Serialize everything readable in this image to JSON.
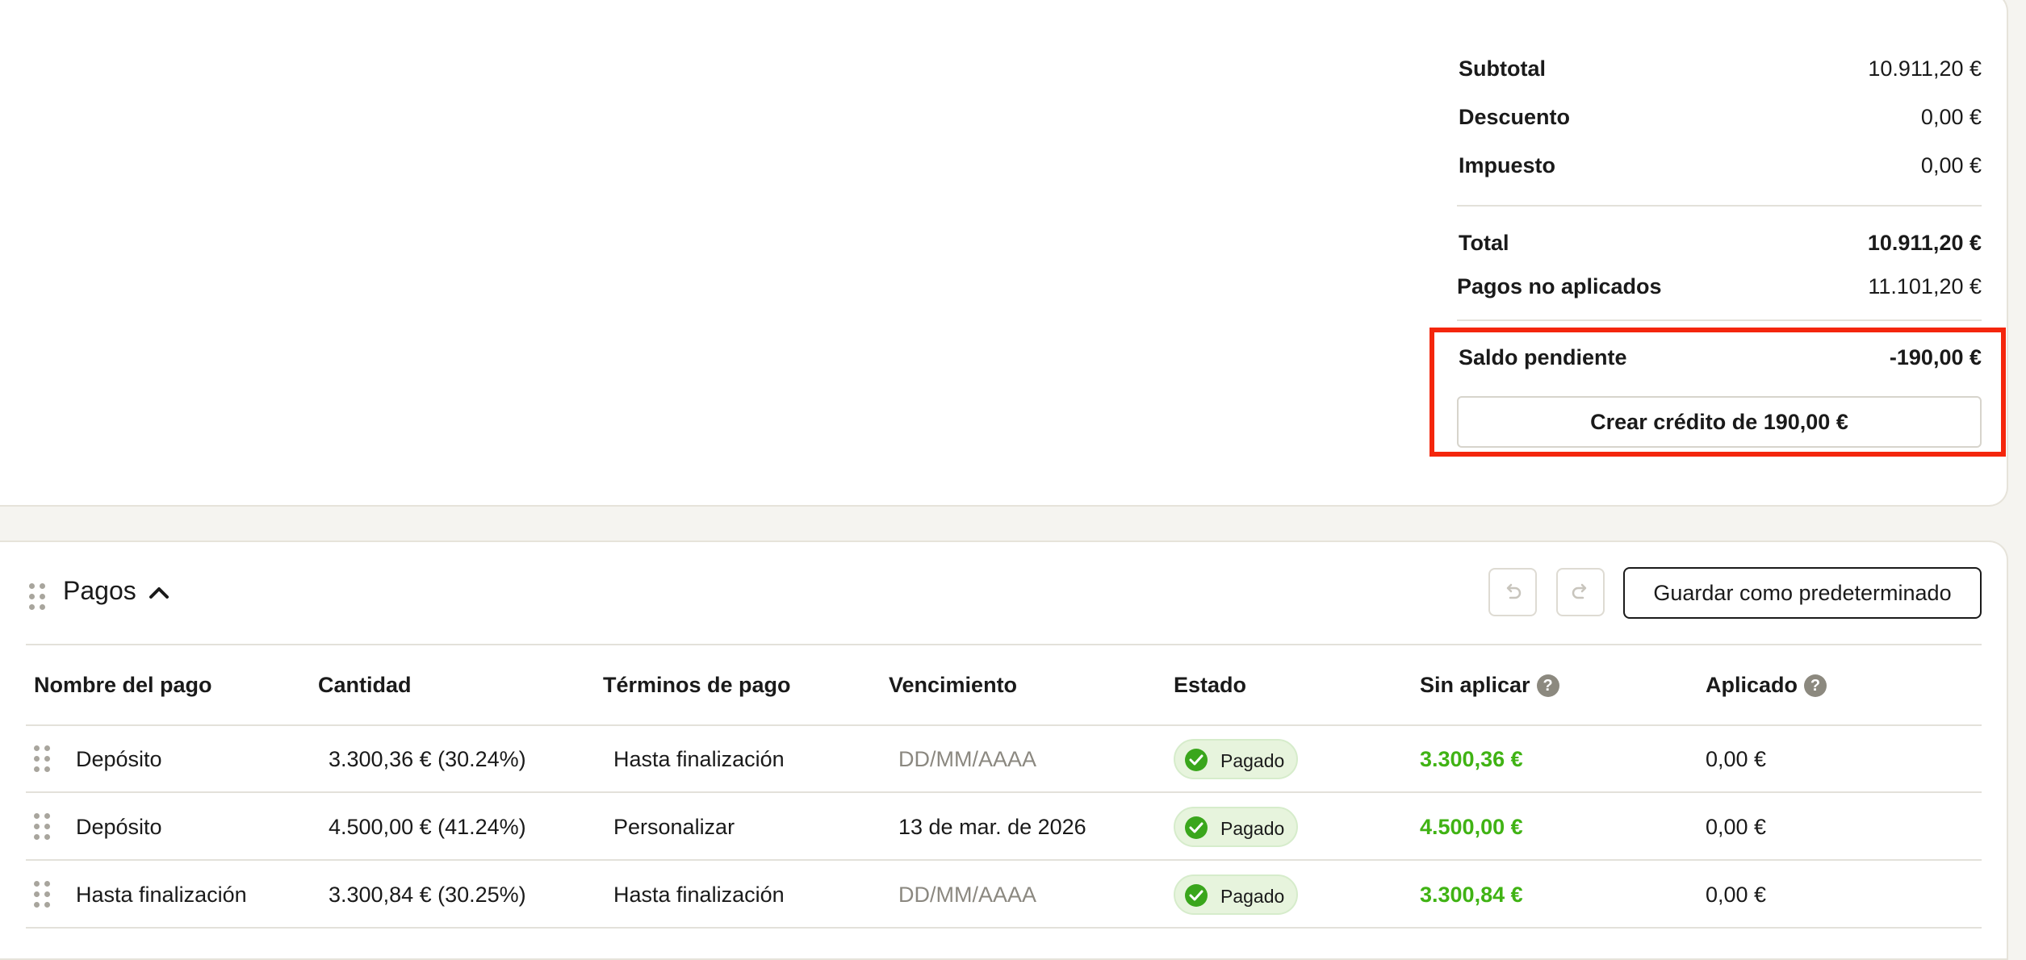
{
  "summary": {
    "subtotal_label": "Subtotal",
    "subtotal_value": "10.911,20 €",
    "discount_label": "Descuento",
    "discount_value": "0,00 €",
    "tax_label": "Impuesto",
    "tax_value": "0,00 €",
    "total_label": "Total",
    "total_value": "10.911,20 €",
    "unapplied_label": "Pagos no aplicados",
    "unapplied_value": "11.101,20 €",
    "balance_label": "Saldo pendiente",
    "balance_value": "-190,00 €",
    "credit_button": "Crear crédito de 190,00 €"
  },
  "payments": {
    "title": "Pagos",
    "save_default_button": "Guardar como predeterminado",
    "columns": {
      "name": "Nombre del pago",
      "amount": "Cantidad",
      "terms": "Términos de pago",
      "due": "Vencimiento",
      "status": "Estado",
      "unapplied": "Sin aplicar",
      "applied": "Aplicado"
    },
    "rows": [
      {
        "name": "Depósito",
        "amount": "3.300,36 € (30.24%)",
        "terms": "Hasta finalización",
        "due": "DD/MM/AAAA",
        "status": "Pagado",
        "unapplied": "3.300,36 €",
        "applied": "0,00 €"
      },
      {
        "name": "Depósito",
        "amount": "4.500,00 € (41.24%)",
        "terms": "Personalizar",
        "due": "13 de mar. de 2026",
        "status": "Pagado",
        "unapplied": "4.500,00 €",
        "applied": "0,00 €"
      },
      {
        "name": "Hasta finalización",
        "amount": "3.300,84 € (30.25%)",
        "terms": "Hasta finalización",
        "due": "DD/MM/AAAA",
        "status": "Pagado",
        "unapplied": "3.300,84 €",
        "applied": "0,00 €"
      }
    ]
  },
  "colors": {
    "highlight": "#f4260c",
    "paid_green": "#40b314",
    "badge_bg": "#e7f4dd"
  },
  "icons": [
    "drag-handle-icon",
    "chevron-up-icon",
    "undo-icon",
    "redo-icon",
    "help-icon",
    "check-circle-icon"
  ]
}
